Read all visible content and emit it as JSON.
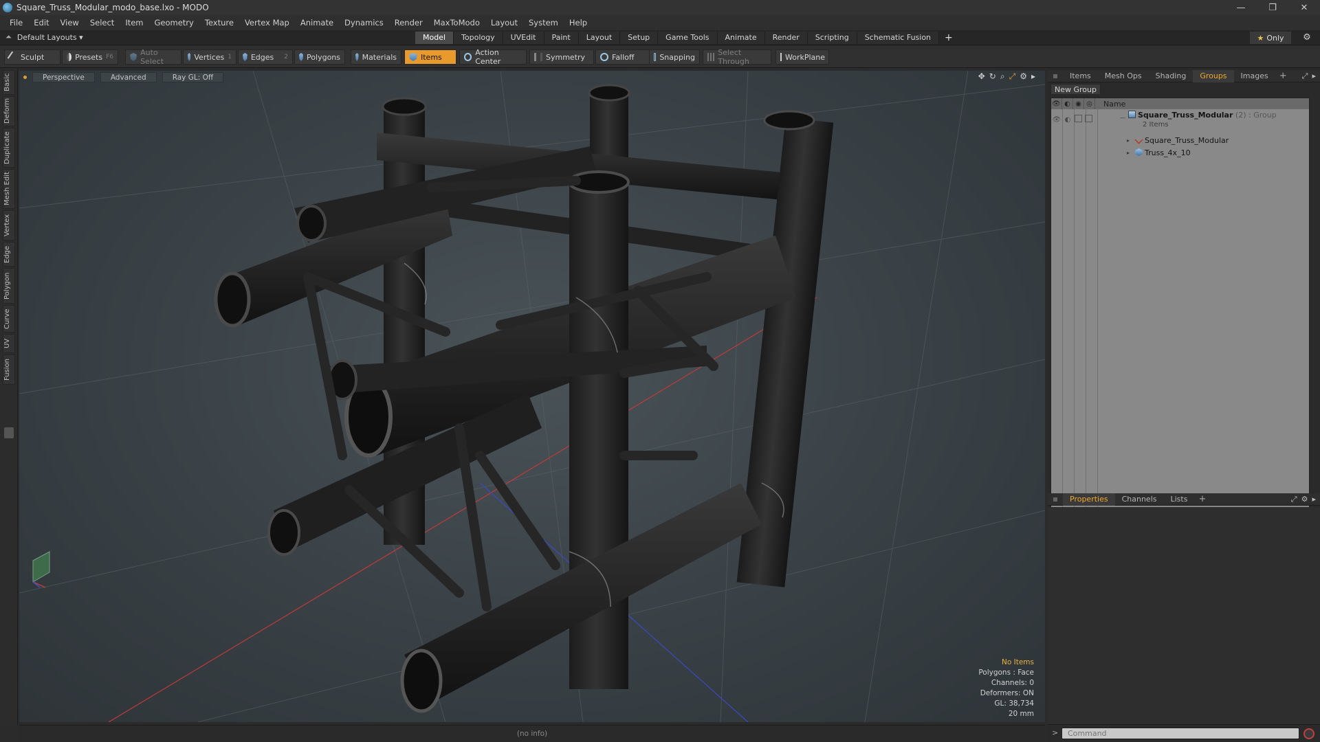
{
  "window": {
    "title": "Square_Truss_Modular_modo_base.lxo - MODO",
    "minimize": "—",
    "maximize": "❐",
    "close": "✕"
  },
  "menu": [
    "File",
    "Edit",
    "View",
    "Select",
    "Item",
    "Geometry",
    "Texture",
    "Vertex Map",
    "Animate",
    "Dynamics",
    "Render",
    "MaxToModo",
    "Layout",
    "System",
    "Help"
  ],
  "layoutbar": {
    "layout_name": "Default Layouts ▾",
    "tabs": [
      "Model",
      "Topology",
      "UVEdit",
      "Paint",
      "Layout",
      "Setup",
      "Game Tools",
      "Animate",
      "Render",
      "Scripting",
      "Schematic Fusion"
    ],
    "active_tab": "Model",
    "plus": "+",
    "only_star": "★",
    "only_label": "Only",
    "gear": "⚙"
  },
  "toolbar": {
    "sculpt": "Sculpt",
    "presets": "Presets",
    "presets_key": "F6",
    "auto_select": "Auto Select",
    "vertices": "Vertices",
    "vertices_key": "1",
    "edges": "Edges",
    "edges_key": "2",
    "polygons": "Polygons",
    "materials": "Materials",
    "items": "Items",
    "action_center": "Action Center",
    "symmetry": "Symmetry",
    "falloff": "Falloff",
    "snapping": "Snapping",
    "select_through": "Select Through",
    "workplane": "WorkPlane"
  },
  "left_tabs": [
    "Basic",
    "Deform",
    "Duplicate",
    "Mesh Edit",
    "Vertex",
    "Edge",
    "Polygon",
    "Curve",
    "UV",
    "Fusion"
  ],
  "viewport": {
    "perspective": "Perspective",
    "advanced": "Advanced",
    "raygl": "Ray GL: Off",
    "info": {
      "items": "No Items",
      "polygons": "Polygons : Face",
      "channels": "Channels: 0",
      "deformers": "Deformers: ON",
      "gl": "GL: 38,734",
      "scale": "20 mm"
    }
  },
  "statusbar": {
    "text": "(no info)"
  },
  "right_panel": {
    "tabs": [
      "Items",
      "Mesh Ops",
      "Shading",
      "Groups",
      "Images"
    ],
    "active_tab": "Groups",
    "plus": "+",
    "new_group": "New Group",
    "column_name": "Name",
    "groups": {
      "group_name": "Square_Truss_Modular",
      "group_meta": " (2) : Group",
      "group_count": "2 Items",
      "children": [
        "Square_Truss_Modular",
        "Truss_4x_10"
      ]
    },
    "bottom_tabs": [
      "Properties",
      "Channels",
      "Lists"
    ],
    "bottom_active": "Properties",
    "bottom_plus": "+"
  },
  "command": {
    "placeholder": "Command",
    "arrow": ">"
  },
  "colors": {
    "accent": "#e89a2c",
    "active_tab_text": "#f0a830",
    "axis_red": "#c03a3a",
    "axis_blue": "#3a4ac0"
  }
}
